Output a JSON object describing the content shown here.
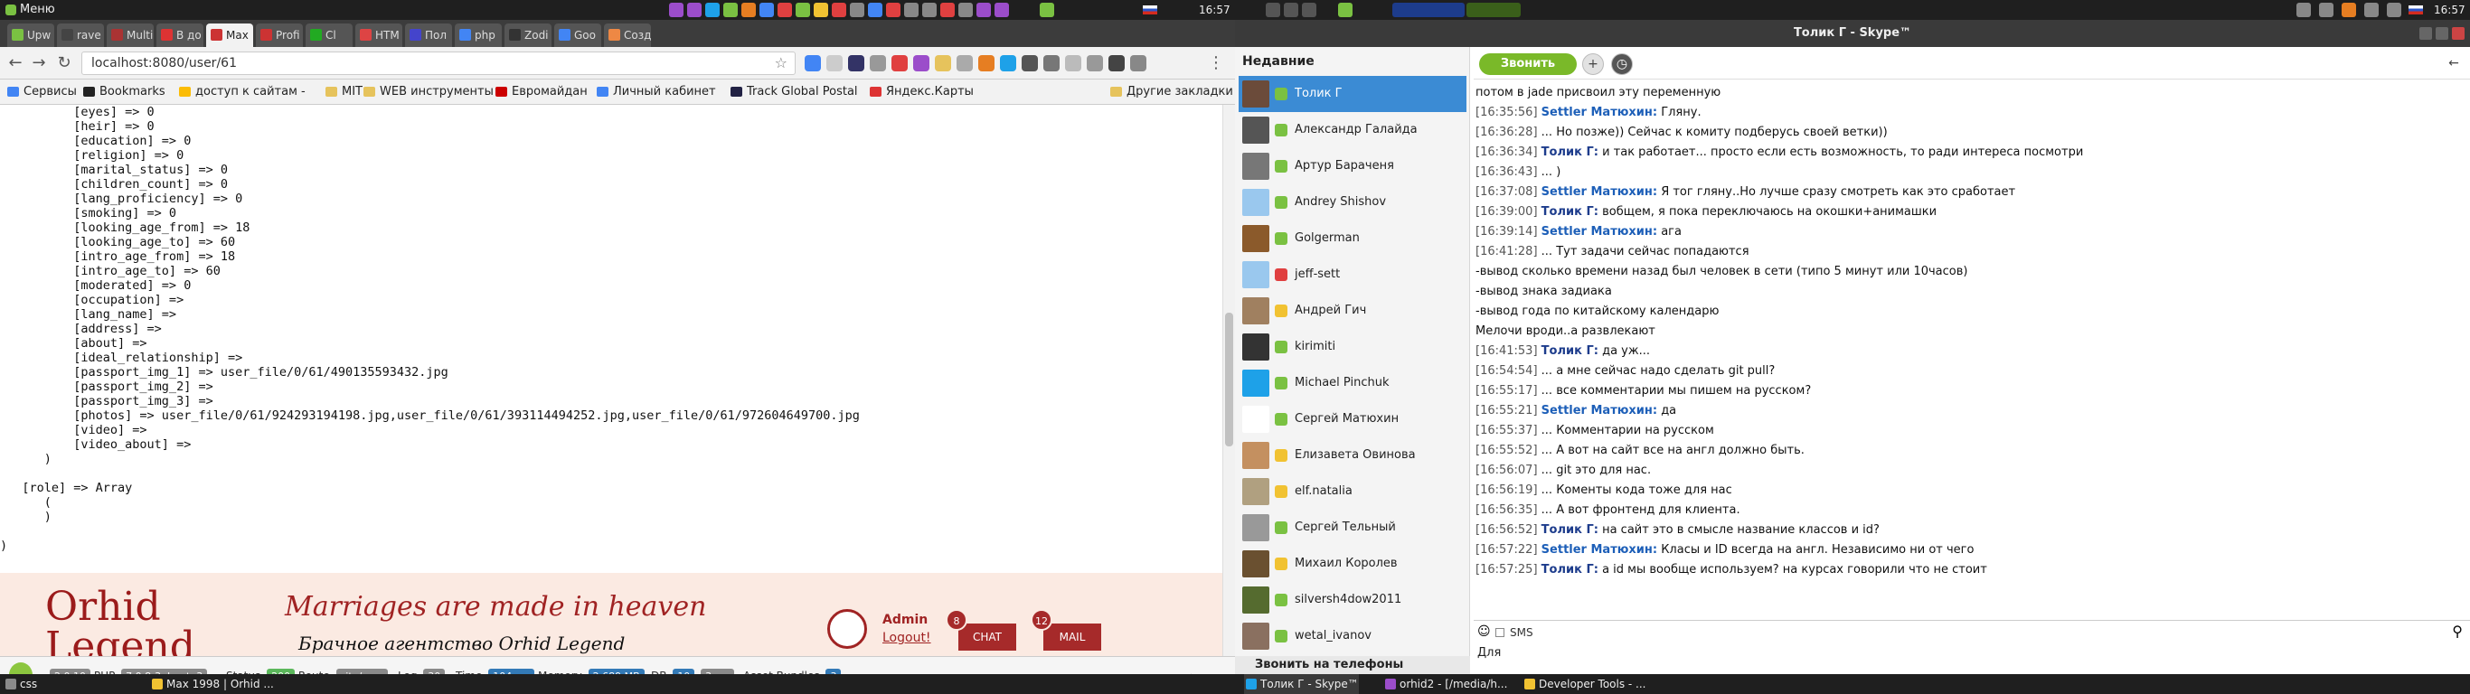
{
  "desktop": {
    "menu_label": "Меню",
    "clock_left": "16:57",
    "clock_right": "16:57",
    "taskbar": [
      {
        "label": "css",
        "color": "#8a8a8a"
      },
      {
        "label": "Max 1998 | Orhid ...",
        "color": "#f1c232"
      },
      {
        "label": "Толик Г - Skype™",
        "color": "#1ea1e8"
      },
      {
        "label": "orhid2 - [/media/h...",
        "color": "#9b4dca"
      },
      {
        "label": "Developer Tools - ...",
        "color": "#f1c232"
      }
    ]
  },
  "browser": {
    "tabs": [
      {
        "label": "Upw",
        "color": "#7ac142"
      },
      {
        "label": "rave",
        "color": "#444"
      },
      {
        "label": "Multi",
        "color": "#a33"
      },
      {
        "label": "В до",
        "color": "#d33"
      },
      {
        "label": "Max",
        "color": "#c33"
      },
      {
        "label": "Profi",
        "color": "#c33"
      },
      {
        "label": "Cl",
        "color": "#2a2"
      },
      {
        "label": "HTM",
        "color": "#d44"
      },
      {
        "label": "Пол",
        "color": "#44c"
      },
      {
        "label": "php",
        "color": "#4285f4"
      },
      {
        "label": "Zodi",
        "color": "#333"
      },
      {
        "label": "Goo",
        "color": "#4285f4"
      },
      {
        "label": "Созд",
        "color": "#e84"
      }
    ],
    "url": "localhost:8080/user/61",
    "bookmarks": [
      {
        "label": "Сервисы",
        "color": "#4285f4"
      },
      {
        "label": "Bookmarks",
        "color": "#222"
      },
      {
        "label": "доступ к сайтам -",
        "color": "#fbbc05"
      },
      {
        "label": "MIT",
        "color": "#e6c35c"
      },
      {
        "label": "WEB инструменты",
        "color": "#e6c35c"
      },
      {
        "label": "Евромайдан",
        "color": "#c00"
      },
      {
        "label": "Личный кабинет",
        "color": "#4285f4"
      },
      {
        "label": "Track Global Postal",
        "color": "#224"
      },
      {
        "label": "Яндекс.Карты",
        "color": "#d33"
      },
      {
        "label": "Другие закладки",
        "color": "#e6c35c"
      }
    ],
    "dump_lines": [
      "          [eyes] => 0",
      "          [heir] => 0",
      "          [education] => 0",
      "          [religion] => 0",
      "          [marital_status] => 0",
      "          [children_count] => 0",
      "          [lang_proficiency] => 0",
      "          [smoking] => 0",
      "          [looking_age_from] => 18",
      "          [looking_age_to] => 60",
      "          [intro_age_from] => 18",
      "          [intro_age_to] => 60",
      "          [moderated] => 0",
      "          [occupation] =>",
      "          [lang_name] =>",
      "          [address] =>",
      "          [about] =>",
      "          [ideal_relationship] =>",
      "          [passport_img_1] => user_file/0/61/490135593432.jpg",
      "          [passport_img_2] =>",
      "          [passport_img_3] =>",
      "          [photos] => user_file/0/61/924293194198.jpg,user_file/0/61/393114494252.jpg,user_file/0/61/972604649700.jpg",
      "          [video] =>",
      "          [video_about] =>",
      "      )",
      "",
      "   [role] => Array",
      "      (",
      "      )",
      "",
      ")"
    ],
    "site": {
      "logo_line1": "Orhid",
      "logo_line2": "Legend",
      "tagline": "Marriages are made in heaven",
      "agency": "Брачное агентство Orhid Legend",
      "admin": "Admin",
      "logout": "Logout!",
      "chat_label": "CHAT",
      "chat_count": "8",
      "mail_label": "MAIL",
      "mail_count": "12"
    },
    "debug": {
      "yii_version": "2.0.10",
      "php_label": "PHP",
      "php_version": "7.0.8-3ubuntu3",
      "status_label": "Status",
      "status_value": "200",
      "route_label": "Route",
      "route_value": "site/user",
      "log_label": "Log",
      "log_value": "30",
      "time_label": "Time",
      "time_value": "104 ms",
      "memory_label": "Memory",
      "memory_value": "2.689 MB",
      "db_label": "DB",
      "db_count": "10",
      "db_time": "3 ms",
      "assets_label": "Asset Bundles",
      "assets_value": "3"
    }
  },
  "skype": {
    "title": "Толик Г - Skype™",
    "recent_label": "Недавние",
    "contacts": [
      {
        "name": "Толик Г",
        "avatar": "#6b4b3a",
        "status": "#7ac142",
        "selected": true
      },
      {
        "name": "Александр Галайда",
        "avatar": "#555",
        "status": "#7ac142"
      },
      {
        "name": "Артур Бараченя",
        "avatar": "#777",
        "status": "#7ac142"
      },
      {
        "name": "Andrey Shishov",
        "avatar": "#9ac8ee",
        "status": "#7ac142"
      },
      {
        "name": "Golgerman",
        "avatar": "#8b5a2b",
        "status": "#7ac142"
      },
      {
        "name": "jeff-sett",
        "avatar": "#9ac8ee",
        "status": "#e04040"
      },
      {
        "name": "Андрей Гич",
        "avatar": "#a08060",
        "status": "#f1c232"
      },
      {
        "name": "kirimiti",
        "avatar": "#333",
        "status": "#7ac142"
      },
      {
        "name": "Michael Pinchuk",
        "avatar": "#1ea1e8",
        "status": "#7ac142"
      },
      {
        "name": "Сергей Матюхин",
        "avatar": "#ffffff",
        "status": "#7ac142"
      },
      {
        "name": "Елизавета Овинова",
        "avatar": "#c49060",
        "status": "#f1c232"
      },
      {
        "name": "elf.natalia",
        "avatar": "#b0a080",
        "status": "#f1c232"
      },
      {
        "name": "Сергей Тельный",
        "avatar": "#999",
        "status": "#7ac142"
      },
      {
        "name": "Михаил Королев",
        "avatar": "#6a5030",
        "status": "#f1c232"
      },
      {
        "name": "silversh4dow2011",
        "avatar": "#556b2f",
        "status": "#7ac142"
      },
      {
        "name": "wetal_ivanov",
        "avatar": "#8a7060",
        "status": "#7ac142"
      }
    ],
    "call_phones": "Звонить на телефоны",
    "call_button": "Звонить",
    "messages": [
      {
        "ts": "",
        "author": "",
        "text": "потом в jade присвоил эту переменную"
      },
      {
        "ts": "[16:35:56]",
        "author": "Settler Матюхин:",
        "text": "Гляну."
      },
      {
        "ts": "[16:36:28]",
        "author": "",
        "text": "... Но позже)) Сейчас к комиту подберусь своей ветки))"
      },
      {
        "ts": "[16:36:34]",
        "author": "Толик Г:",
        "text": "и так работает... просто если есть возможность, то ради интереса посмотри"
      },
      {
        "ts": "[16:36:43]",
        "author": "",
        "text": "... )"
      },
      {
        "ts": "[16:37:08]",
        "author": "Settler Матюхин:",
        "text": "Я тог гляну..Но лучше сразу смотреть как это сработает"
      },
      {
        "ts": "[16:39:00]",
        "author": "Толик Г:",
        "text": "вобщем, я пока переключаюсь на окошки+анимашки"
      },
      {
        "ts": "[16:39:14]",
        "author": "Settler Матюхин:",
        "text": "ага"
      },
      {
        "ts": "[16:41:28]",
        "author": "",
        "text": "... Тут задачи сейчас попадаются"
      },
      {
        "ts": "",
        "author": "",
        "text": "-вывод сколько времени назад был человек в сети (типо 5 минут или 10часов)"
      },
      {
        "ts": "",
        "author": "",
        "text": "-вывод знака задиака"
      },
      {
        "ts": "",
        "author": "",
        "text": "-вывод года по китайскому календарю"
      },
      {
        "ts": "",
        "author": "",
        "text": "Мелочи вроди..а развлекают"
      },
      {
        "ts": "[16:41:53]",
        "author": "Толик Г:",
        "text": "да уж..."
      },
      {
        "ts": "[16:54:54]",
        "author": "",
        "text": "... а мне сейчас надо сделать git pull?"
      },
      {
        "ts": "[16:55:17]",
        "author": "",
        "text": "... все комментарии мы пишем на русском?"
      },
      {
        "ts": "[16:55:21]",
        "author": "Settler Матюхин:",
        "text": "да"
      },
      {
        "ts": "[16:55:37]",
        "author": "",
        "text": "... Комментарии на русском"
      },
      {
        "ts": "[16:55:52]",
        "author": "",
        "text": "... А вот на сайт все на англ должно быть."
      },
      {
        "ts": "[16:56:07]",
        "author": "",
        "text": "... git это для нас."
      },
      {
        "ts": "[16:56:19]",
        "author": "",
        "text": "... Коменты кода тоже для нас"
      },
      {
        "ts": "[16:56:35]",
        "author": "",
        "text": "... А вот фронтенд для клиента."
      },
      {
        "ts": "[16:56:52]",
        "author": "Толик Г:",
        "text": "на сайт это в смысле название классов и id?"
      },
      {
        "ts": "[16:57:22]",
        "author": "Settler Матюхин:",
        "text": "Класы и ID всегда на англ. Независимо ни от чего"
      },
      {
        "ts": "[16:57:25]",
        "author": "Толик Г:",
        "text": "а id мы вообще используем? на курсах говорили что не стоит"
      }
    ],
    "sms_label": "SMS",
    "input_text": "Для"
  }
}
